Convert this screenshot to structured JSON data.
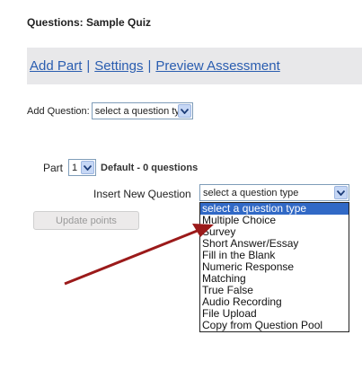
{
  "page": {
    "title": "Questions: Sample Quiz"
  },
  "links": {
    "add_part": "Add Part",
    "settings": "Settings",
    "preview": "Preview Assessment",
    "separator": "|"
  },
  "add_question": {
    "label": "Add Question:",
    "selected": "select a question type"
  },
  "part": {
    "label": "Part",
    "number": "1",
    "default_text": "Default - 0 questions"
  },
  "insert": {
    "label": "Insert New Question",
    "selected": "select a question type"
  },
  "update_button": {
    "label": "Update points"
  },
  "dropdown": {
    "options": [
      "select a question type",
      "Multiple Choice",
      "Survey",
      "Short Answer/Essay",
      "Fill in the Blank",
      "Numeric Response",
      "Matching",
      "True False",
      "Audio Recording",
      "File Upload",
      "Copy from Question Pool"
    ],
    "highlight_color": "#3169c6"
  },
  "annotation": {
    "arrow_color": "#9b1a1a"
  }
}
